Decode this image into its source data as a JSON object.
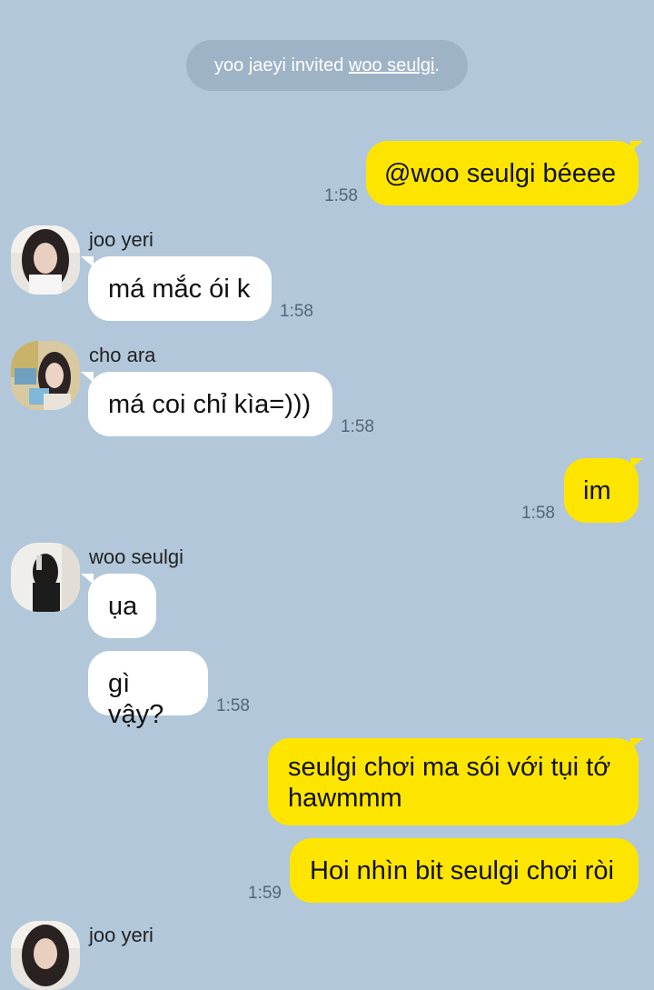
{
  "system": {
    "prefix": "yoo jaeyi invited ",
    "link": "woo seulgi",
    "suffix": "."
  },
  "messages": [
    {
      "text": "@woo seulgi béeee",
      "time": "1:58"
    },
    {
      "sender": "joo yeri",
      "text": "má mắc ói k",
      "time": "1:58"
    },
    {
      "sender": "cho ara",
      "text": "má coi chỉ kìa=)))",
      "time": "1:58"
    },
    {
      "text": "im",
      "time": "1:58"
    },
    {
      "sender": "woo seulgi",
      "text": "ụa"
    },
    {
      "text": "gì vậy?",
      "time": "1:58"
    },
    {
      "text": "seulgi chơi ma sói với tụi tớ hawmmm"
    },
    {
      "text": "Hoi nhìn bit seulgi chơi ròi",
      "time": "1:59"
    },
    {
      "sender": "joo yeri"
    }
  ]
}
